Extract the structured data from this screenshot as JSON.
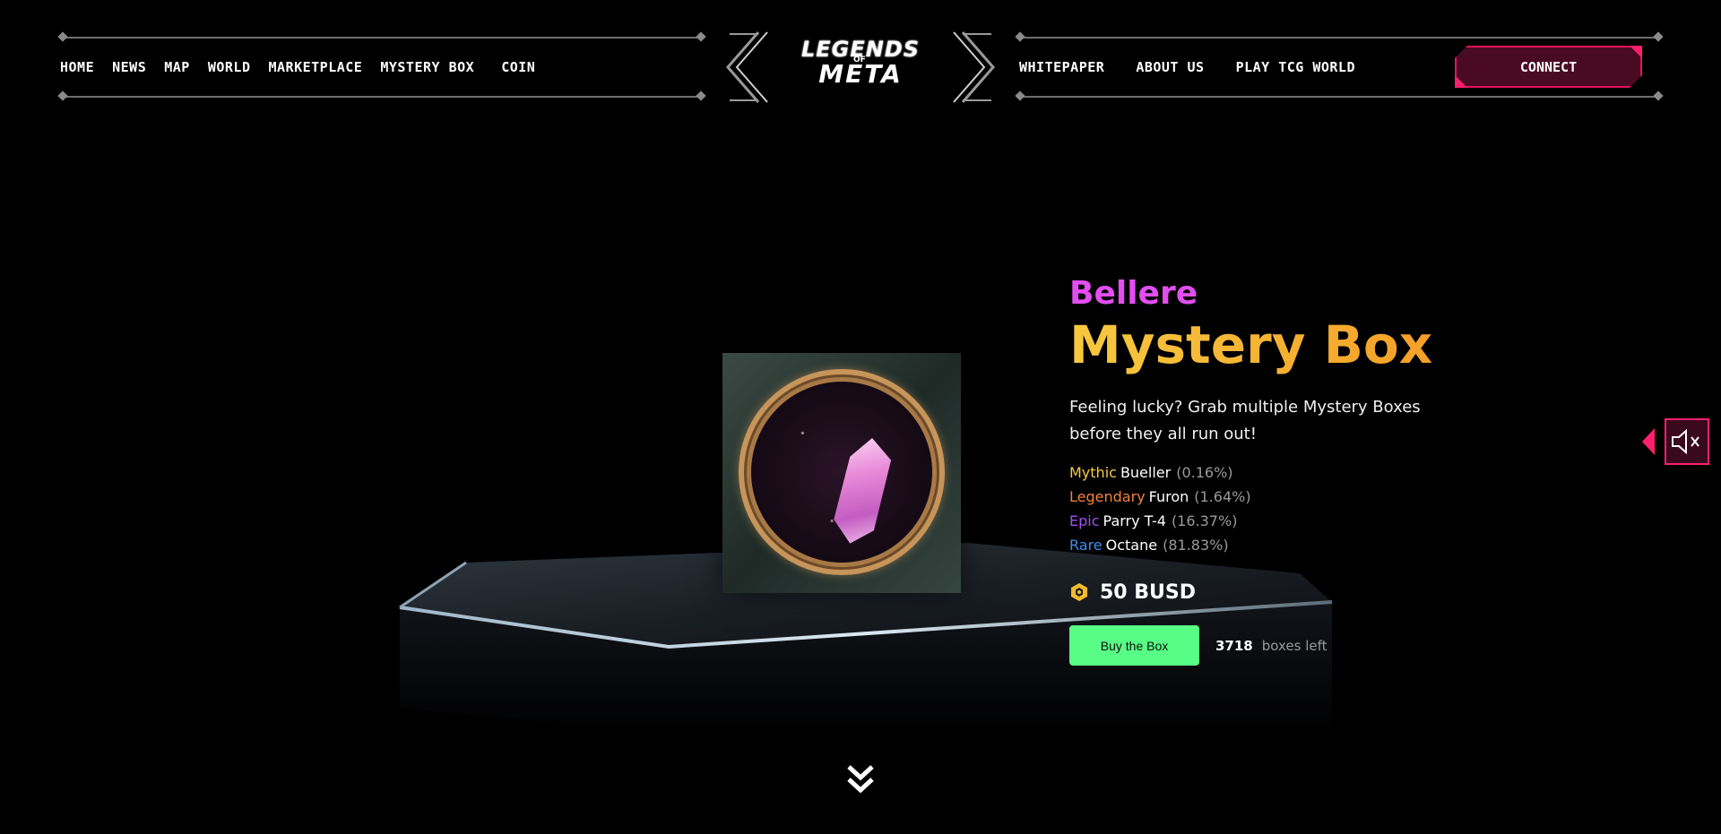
{
  "header": {
    "nav_left": [
      "HOME",
      "NEWS",
      "MAP",
      "WORLD",
      "MARKETPLACE",
      "MYSTERY BOX",
      "COIN"
    ],
    "nav_right": [
      "WHITEPAPER",
      "ABOUT US",
      "PLAY TCG WORLD"
    ],
    "connect_label": "CONNECT",
    "logo": {
      "line1": "LEGENDS",
      "of": "OF",
      "line2": "META"
    }
  },
  "product": {
    "subtitle": "Bellere",
    "title": "Mystery Box",
    "description": "Feeling lucky? Grab multiple Mystery Boxes before they all run out!",
    "drops": [
      {
        "rarity": "Mythic",
        "name": "Bueller",
        "chance": "(0.16%)",
        "color": "#f7c940"
      },
      {
        "rarity": "Legendary",
        "name": "Furon",
        "chance": "(1.64%)",
        "color": "#f3833d"
      },
      {
        "rarity": "Epic",
        "name": "Parry T-4",
        "chance": "(16.37%)",
        "color": "#a54ff0"
      },
      {
        "rarity": "Rare",
        "name": "Octane",
        "chance": "(81.83%)",
        "color": "#3c8ff0"
      }
    ],
    "price": "50 BUSD",
    "price_icon": "bnb-coin-icon",
    "buy_label": "Buy the Box",
    "boxes_left_count": "3718",
    "boxes_left_label": "boxes left"
  },
  "widgets": {
    "sound_icon": "speaker-muted-icon",
    "scroll_icon": "double-chevron-down-icon"
  },
  "colors": {
    "accent_pink": "#ff1f6e",
    "subtitle_magenta": "#e24ef0",
    "title_gold": "#f7c940",
    "title_orange": "#f39a25",
    "buy_green": "#57fd84"
  }
}
